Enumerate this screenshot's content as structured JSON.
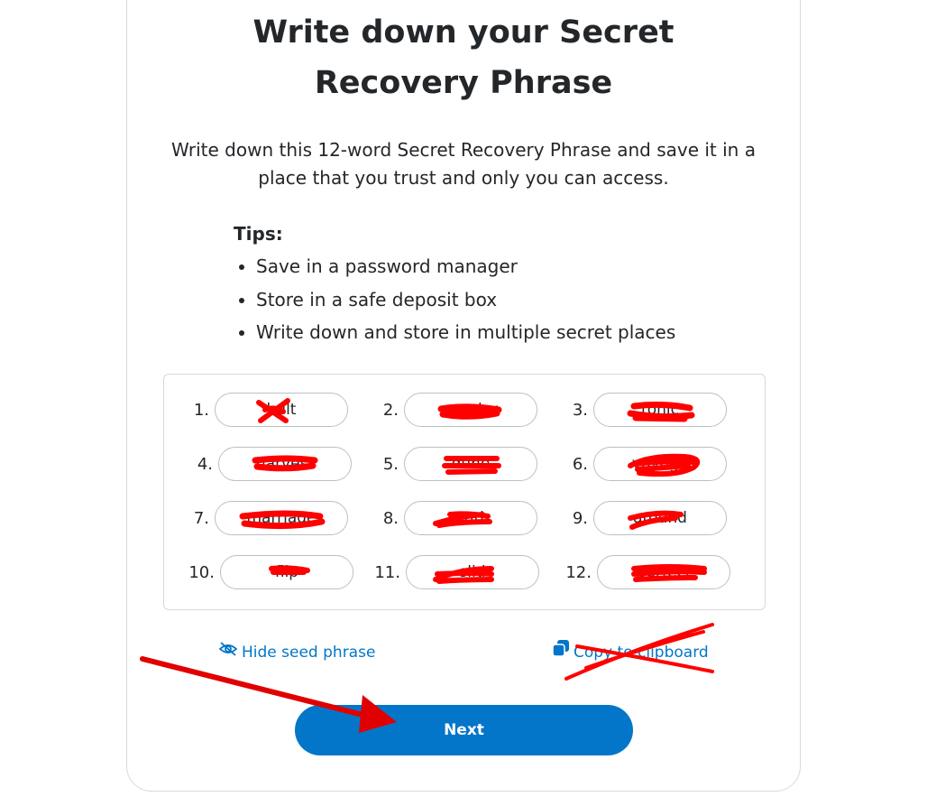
{
  "heading": {
    "line1": "Write down your Secret",
    "line2": "Recovery Phrase"
  },
  "description": "Write down this 12-word Secret Recovery Phrase and save it in a place that you trust and only you can access.",
  "tips": {
    "title": "Tips:",
    "items": [
      "Save in a password manager",
      "Store in a safe deposit box",
      "Write down and store in multiple secret places"
    ]
  },
  "seed_words": [
    {
      "index": "1.",
      "word": "bult"
    },
    {
      "index": "2.",
      "word": "pender"
    },
    {
      "index": "3.",
      "word": "tonic"
    },
    {
      "index": "4.",
      "word": "harvest"
    },
    {
      "index": "5.",
      "word": "dune"
    },
    {
      "index": "6.",
      "word": "voyage"
    },
    {
      "index": "7.",
      "word": "marriage"
    },
    {
      "index": "8.",
      "word": "truth"
    },
    {
      "index": "9.",
      "word": "around"
    },
    {
      "index": "10.",
      "word": "flip"
    },
    {
      "index": "11.",
      "word": "slid"
    },
    {
      "index": "12.",
      "word": "perfect"
    }
  ],
  "actions": {
    "hide_label": "Hide seed phrase",
    "copy_label": "Copy to clipboard",
    "next_label": "Next"
  },
  "colors": {
    "accent": "#0376c9",
    "redaction": "#ff0000",
    "border": "#d6d9dc"
  },
  "icons": [
    "eye-slash-icon",
    "copy-icon"
  ]
}
